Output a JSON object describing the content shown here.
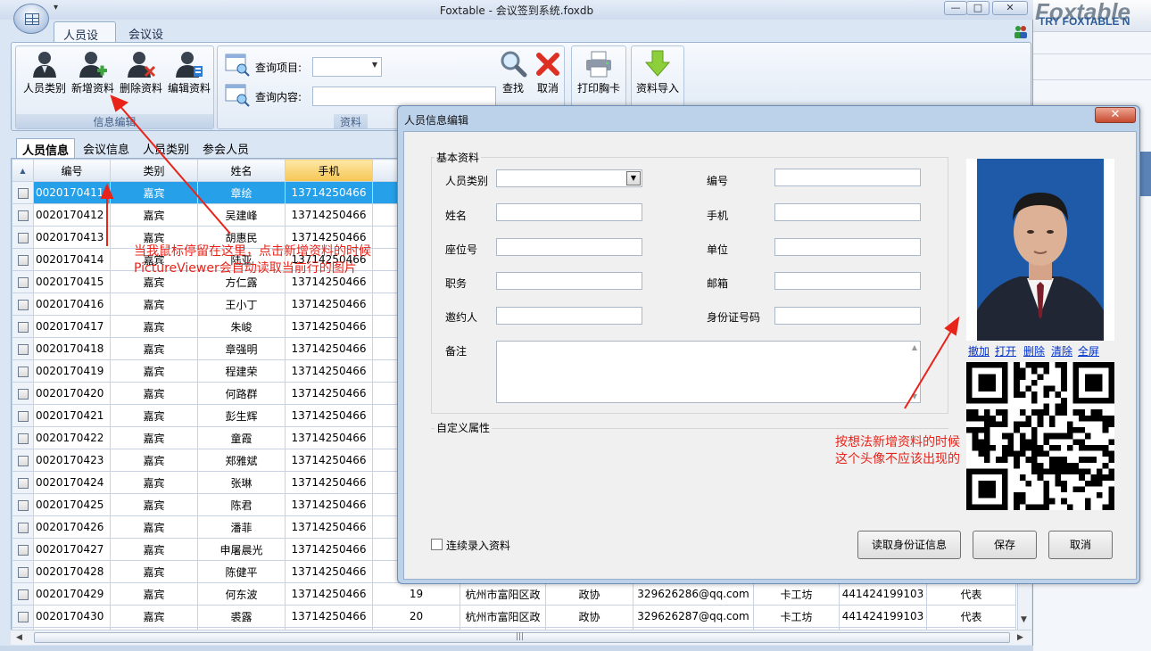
{
  "window": {
    "title": "Foxtable - 会议签到系统.foxdb",
    "qat_glyph": "▾",
    "minimize_glyph": "—",
    "maximize_glyph": "□",
    "close_glyph": "✕"
  },
  "brand": {
    "logo": "Foxtable",
    "tagline": "TRY FOXTABLE N"
  },
  "ribbon": {
    "tabs": [
      "人员设置",
      "会议设置"
    ],
    "groups": {
      "edit_label": "信息编辑",
      "query_label": "资料",
      "buttons": {
        "category": "人员类别",
        "add": "新增资料",
        "delete": "删除资料",
        "edit": "编辑资料"
      },
      "query": {
        "item_label": "查询项目:",
        "content_label": "查询内容:",
        "item_value": "",
        "content_value": "",
        "search": "查找",
        "cancel": "取消"
      },
      "print": "打印胸卡",
      "import": "资料导入"
    }
  },
  "doc_tabs": [
    "人员信息",
    "会议信息",
    "人员类别",
    "参会人员"
  ],
  "grid": {
    "sort_glyph": "▲",
    "columns": [
      "编号",
      "类别",
      "姓名",
      "手机"
    ],
    "selected_row": 0,
    "rows": [
      {
        "id": "0020170411",
        "cat": "嘉宾",
        "name": "章绘",
        "phone": "13714250466"
      },
      {
        "id": "0020170412",
        "cat": "嘉宾",
        "name": "吴建峰",
        "phone": "13714250466"
      },
      {
        "id": "0020170413",
        "cat": "嘉宾",
        "name": "胡惠民",
        "phone": "13714250466"
      },
      {
        "id": "0020170414",
        "cat": "嘉宾",
        "name": "陆亚",
        "phone": "13714250466"
      },
      {
        "id": "0020170415",
        "cat": "嘉宾",
        "name": "方仁露",
        "phone": "13714250466"
      },
      {
        "id": "0020170416",
        "cat": "嘉宾",
        "name": "王小丁",
        "phone": "13714250466"
      },
      {
        "id": "0020170417",
        "cat": "嘉宾",
        "name": "朱峻",
        "phone": "13714250466"
      },
      {
        "id": "0020170418",
        "cat": "嘉宾",
        "name": "章强明",
        "phone": "13714250466"
      },
      {
        "id": "0020170419",
        "cat": "嘉宾",
        "name": "程建荣",
        "phone": "13714250466"
      },
      {
        "id": "0020170420",
        "cat": "嘉宾",
        "name": "何路群",
        "phone": "13714250466"
      },
      {
        "id": "0020170421",
        "cat": "嘉宾",
        "name": "彭生辉",
        "phone": "13714250466"
      },
      {
        "id": "0020170422",
        "cat": "嘉宾",
        "name": "童霞",
        "phone": "13714250466"
      },
      {
        "id": "0020170423",
        "cat": "嘉宾",
        "name": "郑雅斌",
        "phone": "13714250466"
      },
      {
        "id": "0020170424",
        "cat": "嘉宾",
        "name": "张琳",
        "phone": "13714250466"
      },
      {
        "id": "0020170425",
        "cat": "嘉宾",
        "name": "陈君",
        "phone": "13714250466"
      },
      {
        "id": "0020170426",
        "cat": "嘉宾",
        "name": "潘菲",
        "phone": "13714250466"
      },
      {
        "id": "0020170427",
        "cat": "嘉宾",
        "name": "申屠晨光",
        "phone": "13714250466"
      },
      {
        "id": "0020170428",
        "cat": "嘉宾",
        "name": "陈健平",
        "phone": "13714250466"
      },
      {
        "id": "0020170429",
        "cat": "嘉宾",
        "name": "何东波",
        "phone": "13714250466",
        "seat": "19",
        "unit": "杭州市富阳区政",
        "post": "政协",
        "email": "329626286@qq.com",
        "inviter": "卡工坊",
        "idno": "441424199103",
        "note": "代表"
      },
      {
        "id": "0020170430",
        "cat": "嘉宾",
        "name": "裘露",
        "phone": "13714250466",
        "seat": "20",
        "unit": "杭州市富阳区政",
        "post": "政协",
        "email": "329626287@qq.com",
        "inviter": "卡工坊",
        "idno": "441424199103",
        "note": "代表"
      }
    ],
    "partial_row": {
      "id": "0020170431"
    }
  },
  "annotations": {
    "a1_line1": "当我鼠标停留在这里，点击新增资料的时候",
    "a1_line2": "PictureViewer会自动读取当前行的图片",
    "a2_line1": "按想法新增资料的时候",
    "a2_line2": "这个头像不应该出现的"
  },
  "dialog": {
    "title": "人员信息编辑",
    "close_glyph": "✕",
    "basic_legend": "基本资料",
    "custom_legend": "自定义属性",
    "fields": {
      "category": {
        "label": "人员类别",
        "value": ""
      },
      "code": {
        "label": "编号",
        "value": ""
      },
      "name": {
        "label": "姓名",
        "value": ""
      },
      "phone": {
        "label": "手机",
        "value": ""
      },
      "seat": {
        "label": "座位号",
        "value": ""
      },
      "unit": {
        "label": "单位",
        "value": ""
      },
      "post": {
        "label": "职务",
        "value": ""
      },
      "email": {
        "label": "邮箱",
        "value": ""
      },
      "inviter": {
        "label": "邀约人",
        "value": ""
      },
      "idcard": {
        "label": "身份证号码",
        "value": ""
      },
      "remark": {
        "label": "备注",
        "value": ""
      }
    },
    "photo_links": [
      "撤加",
      "打开",
      "删除",
      "清除",
      "全屏"
    ],
    "continuous_label": "连续录入资料",
    "buttons": {
      "read_id": "读取身份证信息",
      "save": "保存",
      "cancel": "取消"
    }
  },
  "colors": {
    "selection": "#26a0e9",
    "annotation": "#e8241a",
    "active_header": "#f6c652",
    "photo_bg": "#1f5aa8"
  }
}
